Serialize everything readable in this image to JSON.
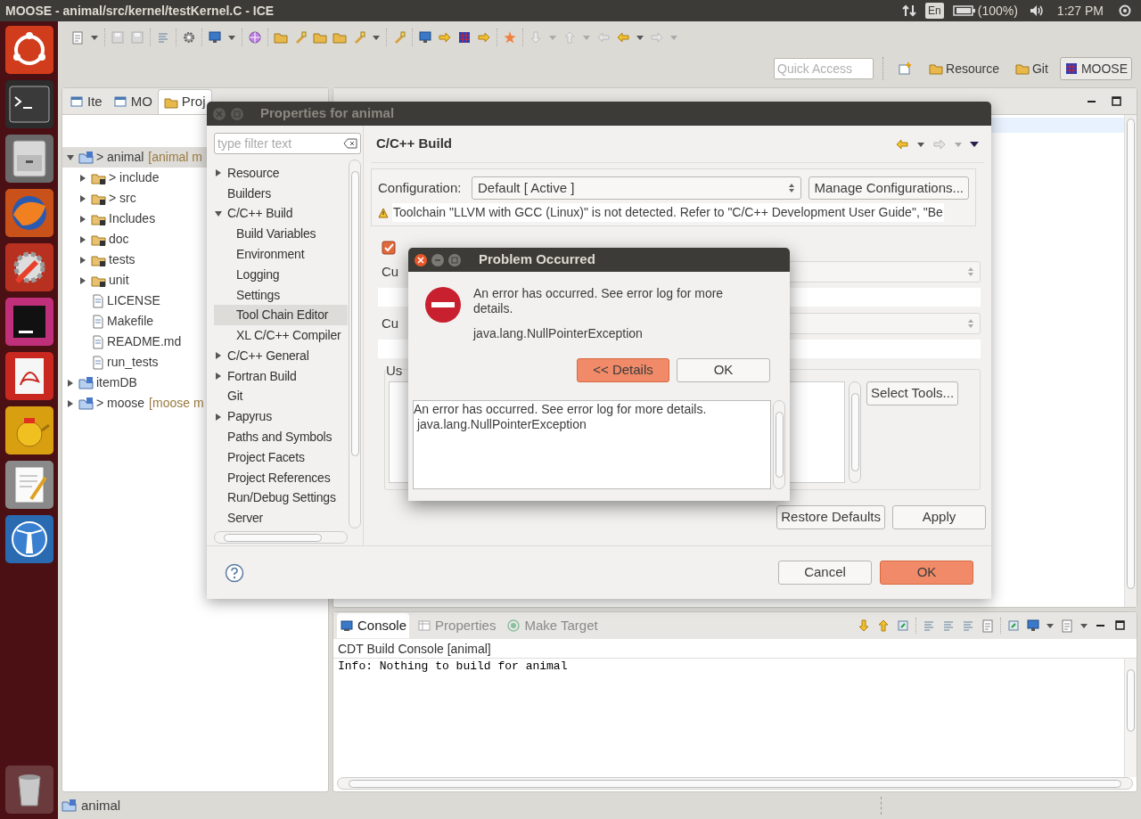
{
  "top_bar": {
    "title": "MOOSE - animal/src/kernel/testKernel.C - ICE",
    "keyboard": "En",
    "battery": "(100%)",
    "time": "1:27 PM"
  },
  "quick_access": {
    "placeholder": "Quick Access"
  },
  "perspectives": [
    {
      "label": "Resource",
      "selected": false
    },
    {
      "label": "Git",
      "selected": false
    },
    {
      "label": "MOOSE",
      "selected": true
    }
  ],
  "left_view": {
    "tabs": [
      {
        "label": "Ite",
        "selected": false
      },
      {
        "label": "MO",
        "selected": false
      },
      {
        "label": "Proj",
        "selected": true
      }
    ],
    "tree": [
      {
        "label": "> animal",
        "decoration": "[animal m",
        "kind": "project",
        "expanded": true,
        "selected": true,
        "children": [
          {
            "label": "> include",
            "kind": "folder",
            "expanded": false,
            "selected": false
          },
          {
            "label": "> src",
            "kind": "folder",
            "expanded": false,
            "selected": false
          },
          {
            "label": "Includes",
            "kind": "folder",
            "expanded": false,
            "selected": false
          },
          {
            "label": "doc",
            "kind": "folder",
            "expanded": false,
            "selected": false
          },
          {
            "label": "tests",
            "kind": "folder",
            "expanded": false,
            "selected": false
          },
          {
            "label": "unit",
            "kind": "folder",
            "expanded": false,
            "selected": false
          },
          {
            "label": "LICENSE",
            "kind": "file",
            "selected": false
          },
          {
            "label": "Makefile",
            "kind": "file",
            "selected": false
          },
          {
            "label": "README.md",
            "kind": "file",
            "selected": false
          },
          {
            "label": "run_tests",
            "kind": "file",
            "selected": false
          }
        ]
      },
      {
        "label": "itemDB",
        "kind": "project",
        "expanded": false,
        "selected": false
      },
      {
        "label": "> moose",
        "decoration": "[moose m",
        "kind": "project",
        "expanded": false,
        "selected": false
      }
    ]
  },
  "properties_dialog": {
    "title": "Properties for animal",
    "filter": {
      "placeholder": "type filter text"
    },
    "nav": [
      {
        "label": "Resource",
        "expanded": false,
        "selected": false
      },
      {
        "label": "Builders",
        "selected": false
      },
      {
        "label": "C/C++ Build",
        "expanded": true,
        "selected": false,
        "children": [
          {
            "label": "Build Variables",
            "selected": false
          },
          {
            "label": "Environment",
            "selected": false
          },
          {
            "label": "Logging",
            "selected": false
          },
          {
            "label": "Settings",
            "selected": false
          },
          {
            "label": "Tool Chain Editor",
            "selected": true
          },
          {
            "label": "XL C/C++ Compiler",
            "selected": false
          }
        ]
      },
      {
        "label": "C/C++ General",
        "expanded": false,
        "selected": false
      },
      {
        "label": "Fortran Build",
        "expanded": false,
        "selected": false
      },
      {
        "label": "Git",
        "selected": false
      },
      {
        "label": "Papyrus",
        "expanded": false,
        "selected": false
      },
      {
        "label": "Paths and Symbols",
        "selected": false
      },
      {
        "label": "Project Facets",
        "selected": false
      },
      {
        "label": "Project References",
        "selected": false
      },
      {
        "label": "Run/Debug Settings",
        "selected": false
      },
      {
        "label": "Server",
        "selected": false
      }
    ],
    "page_title": "C/C++ Build",
    "configuration": {
      "label": "Configuration:",
      "value": "Default  [ Active ]",
      "button": "Manage Configurations..."
    },
    "warning": "Toolchain \"LLVM with GCC (Linux)\" is not detected. Refer to \"C/C++ Development User Guide\", \"Be",
    "checkbox": {
      "checked": true
    },
    "label_1": "Cu",
    "label_2": "Cu",
    "group_label": "Us",
    "select_tools": "Select Tools...",
    "restore_defaults": "Restore Defaults",
    "apply": "Apply",
    "cancel": "Cancel",
    "ok": "OK"
  },
  "problem_dialog": {
    "title": "Problem Occurred",
    "message": "An error has occurred. See error log for more details.",
    "exception": "java.lang.NullPointerException",
    "details_button": "<< Details",
    "ok": "OK",
    "details": [
      "An error has occurred. See error log for more details.",
      " java.lang.NullPointerException"
    ]
  },
  "console": {
    "tabs": [
      {
        "label": "Console",
        "selected": true
      },
      {
        "label": "Properties",
        "selected": false
      },
      {
        "label": "Make Target",
        "selected": false
      }
    ],
    "header": "CDT Build Console [animal]",
    "lines": [
      "Info: Nothing to build for animal"
    ]
  },
  "status_bar": {
    "label": "animal"
  }
}
